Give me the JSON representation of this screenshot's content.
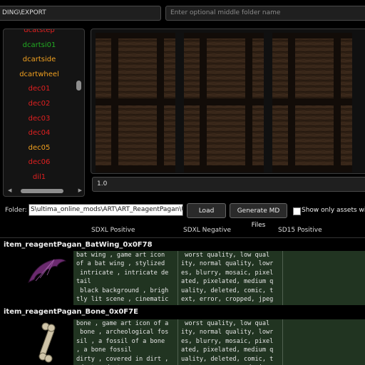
{
  "top": {
    "export_path": "DING\\EXPORT",
    "middle_folder_placeholder": "Enter optional middle folder name"
  },
  "list": {
    "items": [
      {
        "label": "dcatstep",
        "color": "#e02020"
      },
      {
        "label": "dcartsi01",
        "color": "#22aa22"
      },
      {
        "label": "dcartside",
        "color": "#f0a020"
      },
      {
        "label": "dcartwheel",
        "color": "#f0a020"
      },
      {
        "label": "dec01",
        "color": "#e02020"
      },
      {
        "label": "dec02",
        "color": "#e02020"
      },
      {
        "label": "dec03",
        "color": "#e02020"
      },
      {
        "label": "dec04",
        "color": "#e02020"
      },
      {
        "label": "dec05",
        "color": "#f0a020"
      },
      {
        "label": "dec06",
        "color": "#e02020"
      },
      {
        "label": "dil1",
        "color": "#e02020"
      }
    ]
  },
  "preview": {
    "value_field": "1.0"
  },
  "folder": {
    "label": "Folder:",
    "path": "S\\ultima_online_mods\\ART\\ART_ReagentPagan\\Upscale",
    "load_button": "Load",
    "generate_button": "Generate MD Files",
    "show_only_label": "Show only assets with bl"
  },
  "columns": [
    "SDXL Positive",
    "SDXL Negative",
    "SD15 Positive"
  ],
  "rows": [
    {
      "title": "item_reagentPagan_BatWing_0x0F78",
      "icon": "bat-wing-icon",
      "positive": "bat wing , game art icon\nof a bat wing , stylized\n intricate , intricate de\ntail\n black background , brigh\ntly lit scene , cinematic",
      "negative": " worst quality, low qual\nity, normal quality, lowr\nes, blurry, mosaic, pixel\nated, pixelated, medium q\nuality, deleted, comic, t\next, error, cropped, jpeg"
    },
    {
      "title": "item_reagentPagan_Bone_0x0F7E",
      "icon": "bone-icon",
      "positive": "bone , game art icon of a\n bone , archeological fos\nsil , a fossil of a bone\n, a bone fossil\ndirty , covered in dirt ,\n dust , dusty",
      "negative": " worst quality, low qual\nity, normal quality, lowr\nes, blurry, mosaic, pixel\nated, pixelated, medium q\nuality, deleted, comic, t\next, error, cropped, jpeg"
    }
  ]
}
